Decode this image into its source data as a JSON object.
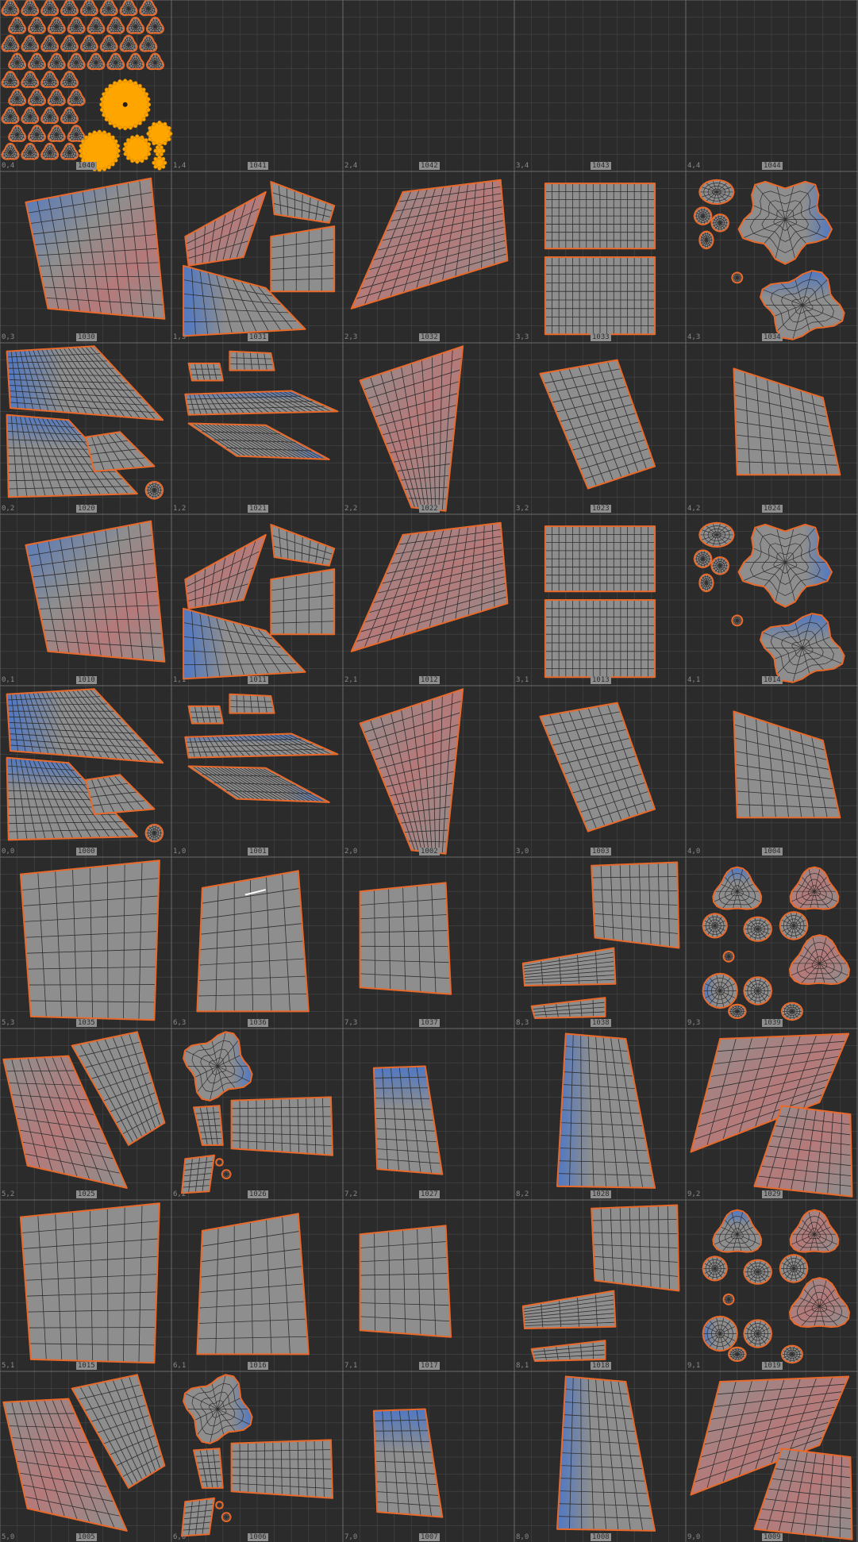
{
  "viewport": {
    "name": "UV Editor",
    "background": "#2b2b2b",
    "grid_line_color": "#474747",
    "tile_border_color": "#6a6a6a",
    "island_fill": "#8e8e8e",
    "island_border": "#e8692a",
    "island_wire": "#2f2f2f",
    "tint_blue": "#4f78c4",
    "tint_red": "#b57a7a",
    "selection_color": "#ffa500"
  },
  "tiles": {
    "columns": 5,
    "rows": 9,
    "rows_data": [
      [
        {
          "coord": "0,4",
          "udim": "1040",
          "type": "packed"
        },
        {
          "coord": "1,4",
          "udim": "1041",
          "type": "empty"
        },
        {
          "coord": "2,4",
          "udim": "1042",
          "type": "empty"
        },
        {
          "coord": "3,4",
          "udim": "1043",
          "type": "empty"
        },
        {
          "coord": "4,4",
          "udim": "1044",
          "type": "empty"
        }
      ],
      [
        {
          "coord": "0,3",
          "udim": "1030",
          "type": "big"
        },
        {
          "coord": "1,3",
          "udim": "1031",
          "type": "pieces"
        },
        {
          "coord": "2,3",
          "udim": "1032",
          "type": "curved"
        },
        {
          "coord": "3,3",
          "udim": "1033",
          "type": "twin"
        },
        {
          "coord": "4,3",
          "udim": "1034",
          "type": "organic"
        }
      ],
      [
        {
          "coord": "0,2",
          "udim": "1020",
          "type": "head"
        },
        {
          "coord": "1,2",
          "udim": "1021",
          "type": "strips"
        },
        {
          "coord": "2,2",
          "udim": "1022",
          "type": "tall"
        },
        {
          "coord": "3,2",
          "udim": "1023",
          "type": "slant"
        },
        {
          "coord": "4,2",
          "udim": "1024",
          "type": "square"
        }
      ],
      [
        {
          "coord": "0,1",
          "udim": "1010",
          "type": "big"
        },
        {
          "coord": "1,1",
          "udim": "1011",
          "type": "pieces"
        },
        {
          "coord": "2,1",
          "udim": "1012",
          "type": "curved"
        },
        {
          "coord": "3,1",
          "udim": "1013",
          "type": "twin"
        },
        {
          "coord": "4,1",
          "udim": "1014",
          "type": "organic"
        }
      ],
      [
        {
          "coord": "0,0",
          "udim": "1000",
          "type": "head"
        },
        {
          "coord": "1,0",
          "udim": "1001",
          "type": "strips"
        },
        {
          "coord": "2,0",
          "udim": "1002",
          "type": "tall"
        },
        {
          "coord": "3,0",
          "udim": "1003",
          "type": "slant"
        },
        {
          "coord": "4,0",
          "udim": "1004",
          "type": "square"
        }
      ],
      [
        {
          "coord": "5,3",
          "udim": "1035",
          "type": "bigquad"
        },
        {
          "coord": "6,3",
          "udim": "1036",
          "type": "quad"
        },
        {
          "coord": "7,3",
          "udim": "1037",
          "type": "smallquad"
        },
        {
          "coord": "8,3",
          "udim": "1038",
          "type": "wedges"
        },
        {
          "coord": "9,3",
          "udim": "1039",
          "type": "shells"
        }
      ],
      [
        {
          "coord": "5,2",
          "udim": "1025",
          "type": "panels"
        },
        {
          "coord": "6,2",
          "udim": "1026",
          "type": "hands"
        },
        {
          "coord": "7,2",
          "udim": "1027",
          "type": "narrow"
        },
        {
          "coord": "8,2",
          "udim": "1028",
          "type": "tallquad"
        },
        {
          "coord": "9,2",
          "udim": "1029",
          "type": "double"
        }
      ],
      [
        {
          "coord": "5,1",
          "udim": "1015",
          "type": "bigquad"
        },
        {
          "coord": "6,1",
          "udim": "1016",
          "type": "quad"
        },
        {
          "coord": "7,1",
          "udim": "1017",
          "type": "smallquad"
        },
        {
          "coord": "8,1",
          "udim": "1018",
          "type": "wedges"
        },
        {
          "coord": "9,1",
          "udim": "1019",
          "type": "shells"
        }
      ],
      [
        {
          "coord": "5,0",
          "udim": "1005",
          "type": "panels"
        },
        {
          "coord": "6,0",
          "udim": "1006",
          "type": "hands"
        },
        {
          "coord": "7,0",
          "udim": "1007",
          "type": "narrow"
        },
        {
          "coord": "8,0",
          "udim": "1008",
          "type": "tallquad"
        },
        {
          "coord": "9,0",
          "udim": "1009",
          "type": "double"
        }
      ]
    ]
  }
}
